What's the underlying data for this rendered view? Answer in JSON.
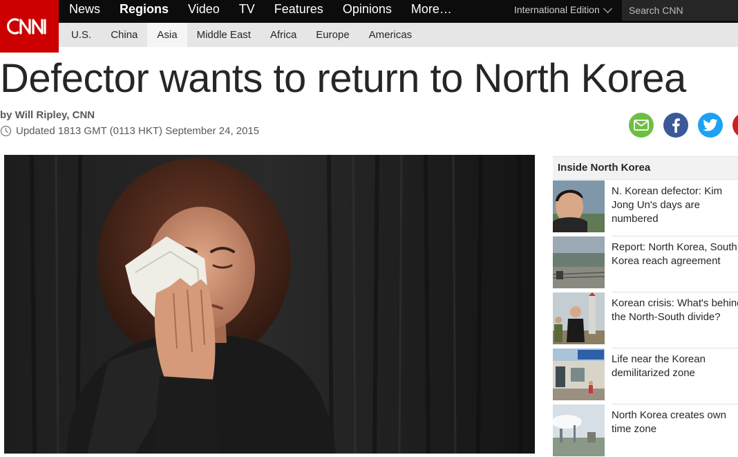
{
  "brand": {
    "logo_text": "CNN",
    "color": "#cc0000"
  },
  "nav": {
    "items": [
      "News",
      "Regions",
      "Video",
      "TV",
      "Features",
      "Opinions",
      "More…"
    ],
    "active": "Regions",
    "edition_label": "International Edition",
    "search_placeholder": "Search CNN"
  },
  "subnav": {
    "items": [
      "U.S.",
      "China",
      "Asia",
      "Middle East",
      "Africa",
      "Europe",
      "Americas"
    ],
    "active": "Asia"
  },
  "article": {
    "headline": "Defector wants to return to North Korea",
    "byline_prefix": "by ",
    "byline_author": "Will Ripley, CNN",
    "updated": "Updated 1813 GMT (0113 HKT) September 24, 2015"
  },
  "share": {
    "icons": [
      "envelope-icon",
      "facebook-icon",
      "twitter-icon",
      "pinterest-icon"
    ],
    "colors": {
      "email": "#6cbf40",
      "facebook": "#3b5998",
      "twitter": "#1da1f2",
      "more": "#cb2027"
    }
  },
  "sidebar": {
    "heading": "Inside North Korea",
    "items": [
      {
        "caption": "N. Korean defector: Kim Jong Un's days are numbered"
      },
      {
        "caption": "Report: North Korea, South Korea reach agreement"
      },
      {
        "caption": "Korean crisis: What's behind the North-South divide?"
      },
      {
        "caption": "Life near the Korean demilitarized zone"
      },
      {
        "caption": "North Korea creates own time zone"
      }
    ]
  }
}
